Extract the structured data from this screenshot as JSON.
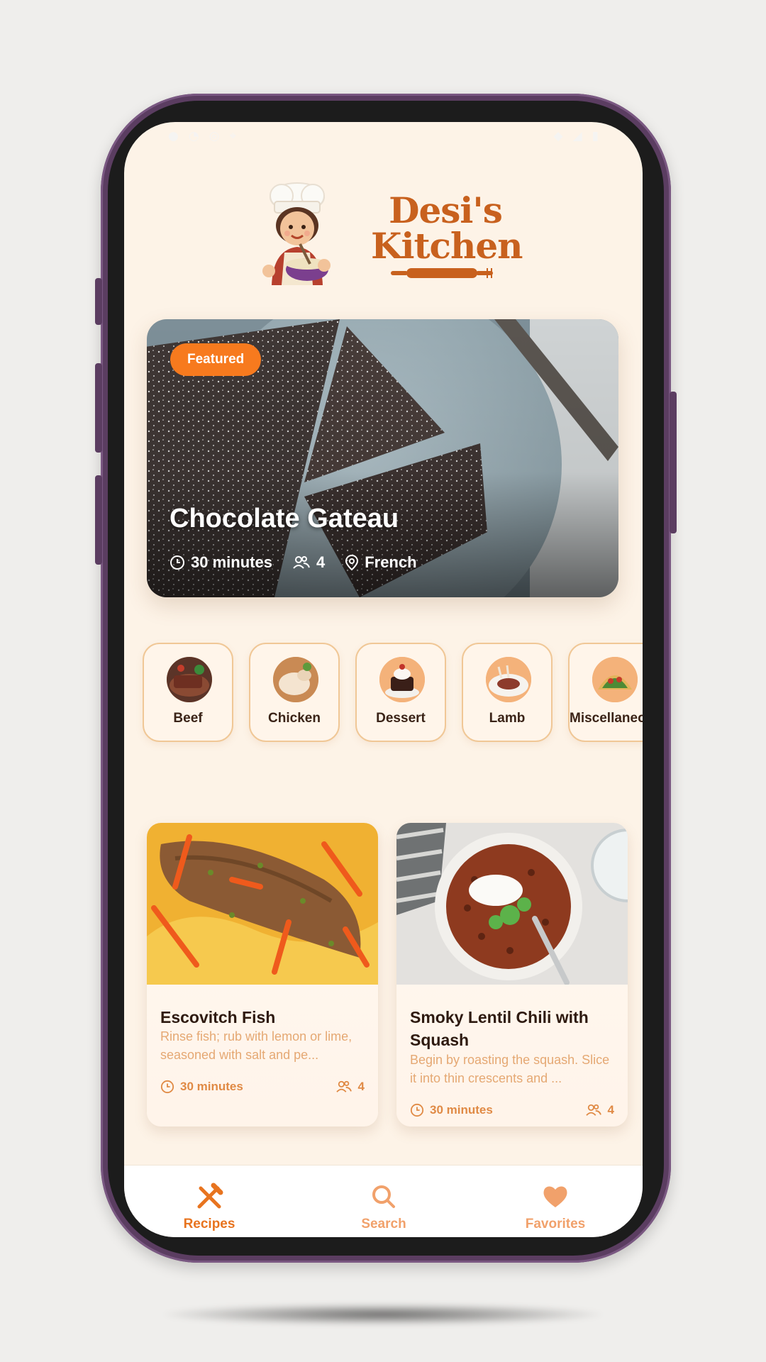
{
  "app": {
    "brand_line1": "Desi's",
    "brand_line2": "Kitchen"
  },
  "featured": {
    "badge": "Featured",
    "title": "Chocolate Gateau",
    "time": "30 minutes",
    "servings": "4",
    "cuisine": "French"
  },
  "categories": [
    {
      "label": "Beef"
    },
    {
      "label": "Chicken"
    },
    {
      "label": "Dessert"
    },
    {
      "label": "Lamb"
    },
    {
      "label": "Miscellaneous"
    }
  ],
  "recipes": [
    {
      "title": "Escovitch Fish",
      "description": "Rinse fish; rub with lemon or lime, seasoned with salt and pe...",
      "time": "30 minutes",
      "servings": "4"
    },
    {
      "title": "Smoky Lentil Chili with Squash",
      "description": "Begin by roasting the squash. Slice it into thin crescents and ...",
      "time": "30 minutes",
      "servings": "4"
    }
  ],
  "nav": {
    "recipes": "Recipes",
    "search": "Search",
    "favorites": "Favorites"
  },
  "colors": {
    "accent": "#f77a1e",
    "brand": "#c8611e",
    "background": "#fdf3e7",
    "nav_active": "#e8741f",
    "nav_inactive": "#f1a16b"
  }
}
